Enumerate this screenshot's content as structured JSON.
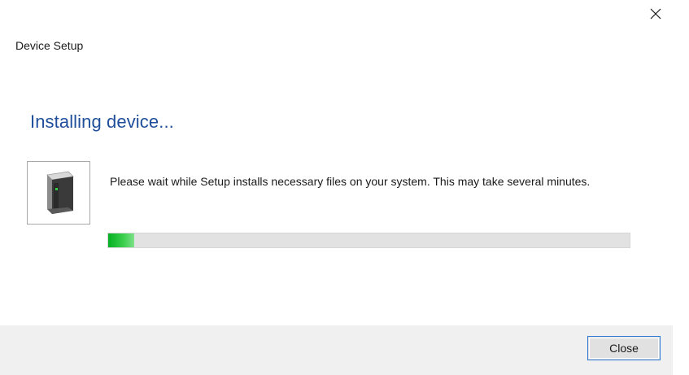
{
  "window": {
    "title": "Device Setup",
    "close_icon": "close-icon"
  },
  "main": {
    "heading": "Installing device...",
    "device_icon": "device-icon",
    "message": "Please wait while Setup installs necessary files on your system. This may take several minutes.",
    "progress_fraction": 0.05
  },
  "footer": {
    "close_label": "Close"
  },
  "colors": {
    "heading": "#1f4e9a",
    "progress_fill": "#06b025",
    "progress_track": "#e2e2e2",
    "button_border": "#2b7bd6",
    "footer_bg": "#f0f0f0"
  }
}
